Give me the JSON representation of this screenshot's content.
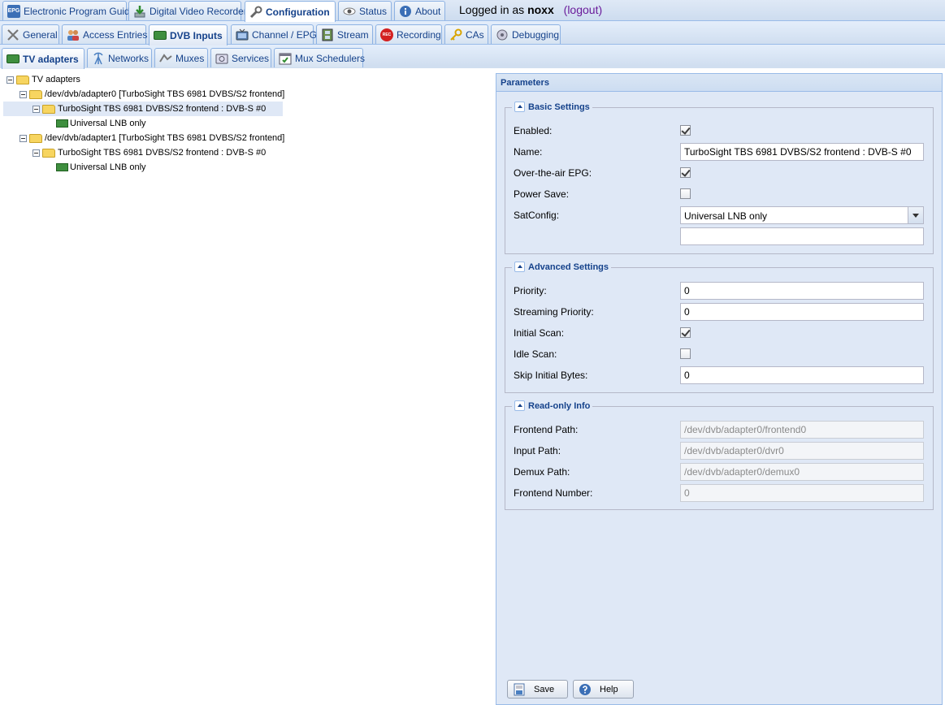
{
  "top_tabs": [
    {
      "label": "Electronic Program Guide",
      "icon": "epg-icon"
    },
    {
      "label": "Digital Video Recorder",
      "icon": "download-icon"
    },
    {
      "label": "Configuration",
      "icon": "wrench-icon"
    },
    {
      "label": "Status",
      "icon": "eye-icon"
    },
    {
      "label": "About",
      "icon": "info-icon"
    }
  ],
  "login": {
    "prefix": "Logged in as",
    "user": "noxx",
    "logout": "(logout)"
  },
  "config_tabs": [
    {
      "label": "General",
      "icon": "tools-icon"
    },
    {
      "label": "Access Entries",
      "icon": "users-icon"
    },
    {
      "label": "DVB Inputs",
      "icon": "tv-card-icon"
    },
    {
      "label": "Channel / EPG",
      "icon": "tv-icon"
    },
    {
      "label": "Stream",
      "icon": "film-icon"
    },
    {
      "label": "Recording",
      "icon": "rec-icon"
    },
    {
      "label": "CAs",
      "icon": "key-icon"
    },
    {
      "label": "Debugging",
      "icon": "bug-icon"
    }
  ],
  "dvb_tabs": [
    {
      "label": "TV adapters",
      "icon": "tv-card-icon"
    },
    {
      "label": "Networks",
      "icon": "antenna-icon"
    },
    {
      "label": "Muxes",
      "icon": "muxes-icon"
    },
    {
      "label": "Services",
      "icon": "services-icon"
    },
    {
      "label": "Mux Schedulers",
      "icon": "scheduler-icon"
    }
  ],
  "tree": [
    {
      "label": "TV adapters",
      "type": "folder"
    },
    {
      "label": "/dev/dvb/adapter0 [TurboSight TBS 6981 DVBS/S2 frontend]",
      "type": "folder"
    },
    {
      "label": "TurboSight TBS 6981 DVBS/S2 frontend : DVB-S #0",
      "type": "folder",
      "selected": true
    },
    {
      "label": "Universal LNB only",
      "type": "card"
    },
    {
      "label": "/dev/dvb/adapter1 [TurboSight TBS 6981 DVBS/S2 frontend]",
      "type": "folder"
    },
    {
      "label": "TurboSight TBS 6981 DVBS/S2 frontend : DVB-S #0",
      "type": "folder"
    },
    {
      "label": "Universal LNB only",
      "type": "card"
    }
  ],
  "panel": {
    "title": "Parameters",
    "basic": {
      "legend": "Basic Settings",
      "enabled_label": "Enabled:",
      "enabled": true,
      "name_label": "Name:",
      "name_value": "TurboSight TBS 6981 DVBS/S2 frontend : DVB-S #0",
      "epg_label": "Over-the-air EPG:",
      "epg": true,
      "power_label": "Power Save:",
      "power": false,
      "satconfig_label": "SatConfig:",
      "satconfig_value": "Universal LNB only",
      "extra_value": ""
    },
    "advanced": {
      "legend": "Advanced Settings",
      "priority_label": "Priority:",
      "priority_value": "0",
      "stream_priority_label": "Streaming Priority:",
      "stream_priority_value": "0",
      "initial_scan_label": "Initial Scan:",
      "initial_scan": true,
      "idle_scan_label": "Idle Scan:",
      "idle_scan": false,
      "skip_label": "Skip Initial Bytes:",
      "skip_value": "0"
    },
    "readonly": {
      "legend": "Read-only Info",
      "frontend_path_label": "Frontend Path:",
      "frontend_path": "/dev/dvb/adapter0/frontend0",
      "input_path_label": "Input Path:",
      "input_path": "/dev/dvb/adapter0/dvr0",
      "demux_path_label": "Demux Path:",
      "demux_path": "/dev/dvb/adapter0/demux0",
      "frontend_number_label": "Frontend Number:",
      "frontend_number": "0"
    },
    "save_label": "Save",
    "help_label": "Help"
  }
}
